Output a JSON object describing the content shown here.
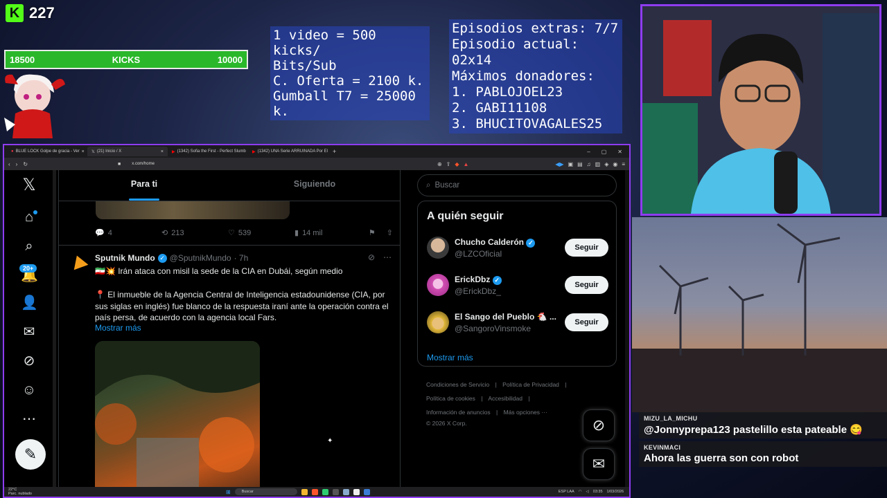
{
  "overlay": {
    "kick_count": "227",
    "kick_logo": "K",
    "goal_bar": {
      "left": "18500",
      "center": "KICKS",
      "right": "10000"
    },
    "info_left": [
      "1 video = 500 kicks/",
      "Bits/Sub",
      "C. Oferta = 2100 k.",
      "Gumball T7 = 25000 k."
    ],
    "info_right": [
      "Episodios extras: 7/7",
      "Episodio actual: 02x14",
      "Máximos donadores:",
      "1. PABLOJOEL23",
      "2. GABI11108",
      "3. BHUCITOVAGALES25"
    ]
  },
  "chat": [
    {
      "user": "MIZU_LA_MICHU",
      "text": "@Jonnyprepa123 pastelillo esta pateable 😋"
    },
    {
      "user": "KEVINMACI",
      "text": "Ahora las guerra son con robot"
    }
  ],
  "browser": {
    "tabs": [
      {
        "label": "BLUE LOCK Golpe de gracia - Ver",
        "active": false
      },
      {
        "label": "(21) Inicio / X",
        "active": true
      },
      {
        "label": "(1342) Sofia the First - Perfect Slumb",
        "active": false
      },
      {
        "label": "(1342) UNA Serie ARRUINADA Por El",
        "active": false
      }
    ],
    "url": "x.com/home"
  },
  "x": {
    "logo": "𝕏",
    "notif_badge": "20+",
    "tabs": {
      "for_you": "Para ti",
      "following": "Siguiendo"
    },
    "prev_actions": {
      "replies": "4",
      "reposts": "213",
      "likes": "539",
      "views": "14 mil"
    },
    "tweet": {
      "name": "Sputnik Mundo",
      "handle": "@SputnikMundo",
      "time": "· 7h",
      "headline": "🇮🇷💥 Irán ataca con misil la sede de la CIA en Dubái, según medio",
      "body": "📍 El inmueble de la Agencia Central de Inteligencia estadounidense (CIA, por sus siglas en inglés) fue blanco de la respuesta iraní ante la operación contra el país persa, de acuerdo con la agencia local Fars.",
      "more": "Mostrar más"
    },
    "search_placeholder": "Buscar",
    "who_to_follow": {
      "title": "A quién seguir",
      "follow_label": "Seguir",
      "users": [
        {
          "name": "Chucho Calderón",
          "handle": "@LZCOficial",
          "verified": true
        },
        {
          "name": "ErickDbz",
          "handle": "@ErickDbz_",
          "verified": true
        },
        {
          "name": "El Sango del Pueblo 🐔 ...",
          "handle": "@SangoroVinsmoke",
          "verified": false
        }
      ],
      "more": "Mostrar más"
    },
    "footer": {
      "terms": "Condiciones de Servicio",
      "privacy": "Política de Privacidad",
      "cookies": "Política de cookies",
      "accessibility": "Accesibilidad",
      "ads": "Información de anuncios",
      "more": "Más opciones ···",
      "copyright": "© 2026 X Corp."
    }
  },
  "taskbar": {
    "weather_temp": "22°C",
    "weather_desc": "Parc. nublado",
    "search": "Buscar",
    "lang": "ESP LAA",
    "time": "03:35",
    "date": "1/03/2026"
  }
}
